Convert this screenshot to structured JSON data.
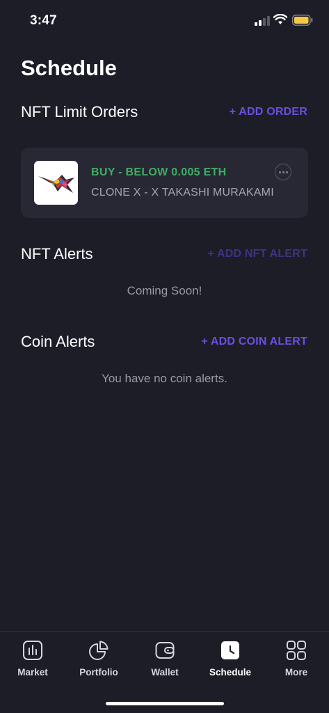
{
  "status_bar": {
    "time": "3:47"
  },
  "page": {
    "title": "Schedule"
  },
  "limit_orders": {
    "title": "NFT Limit Orders",
    "action": "+ ADD ORDER",
    "orders": [
      {
        "type": "BUY - BELOW 0.005 ETH",
        "collection": "CLONE X - X TAKASHI MURAKAMI"
      }
    ]
  },
  "nft_alerts": {
    "title": "NFT Alerts",
    "action": "+ ADD NFT ALERT",
    "empty_text": "Coming Soon!"
  },
  "coin_alerts": {
    "title": "Coin Alerts",
    "action": "+ ADD COIN ALERT",
    "empty_text": "You have no coin alerts."
  },
  "tab_bar": {
    "tabs": [
      {
        "label": "Market",
        "icon": "bar-chart-icon"
      },
      {
        "label": "Portfolio",
        "icon": "pie-chart-icon"
      },
      {
        "label": "Wallet",
        "icon": "wallet-icon"
      },
      {
        "label": "Schedule",
        "icon": "clock-icon",
        "active": true
      },
      {
        "label": "More",
        "icon": "grid-icon"
      }
    ]
  },
  "colors": {
    "background": "#1d1d28",
    "card": "#282835",
    "accent": "#6b4fe0",
    "buy_green": "#3fae63",
    "battery": "#f5c842"
  }
}
